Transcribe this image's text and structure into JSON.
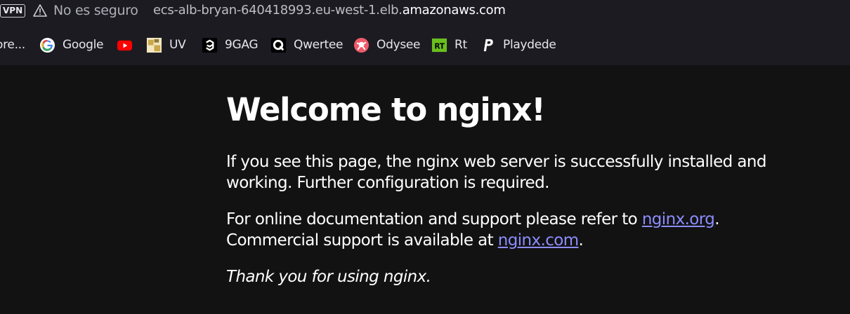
{
  "addressbar": {
    "vpn_label": "VPN",
    "security_text": "No es seguro",
    "url_prefix": "ecs-alb-bryan-640418993.eu-west-1.elb.",
    "url_host": "amazonaws.com"
  },
  "bookmarks": [
    {
      "label": "ore...",
      "icon": "folder-icon"
    },
    {
      "label": "Google",
      "icon": "google-icon"
    },
    {
      "label": "",
      "icon": "youtube-icon"
    },
    {
      "label": "UV",
      "icon": "uv-icon"
    },
    {
      "label": "9GAG",
      "icon": "9gag-icon"
    },
    {
      "label": "Qwertee",
      "icon": "qwertee-icon"
    },
    {
      "label": "Odysee",
      "icon": "odysee-icon"
    },
    {
      "label": "Rt",
      "icon": "rt-icon"
    },
    {
      "label": "Playdede",
      "icon": "playdede-icon"
    }
  ],
  "page": {
    "title": "Welcome to nginx!",
    "p1": "If you see this page, the nginx web server is successfully installed and working. Further configuration is required.",
    "p2_prefix": "For online documentation and support please refer to ",
    "p2_link1": "nginx.org",
    "p2_mid": ".",
    "p2_line2_prefix": "Commercial support is available at ",
    "p2_link2": "nginx.com",
    "p2_suffix": ".",
    "p3": "Thank you for using nginx."
  },
  "colors": {
    "background": "#121212",
    "toolbar": "#1c1b22",
    "link": "#8c8cff",
    "text": "#ffffff"
  }
}
